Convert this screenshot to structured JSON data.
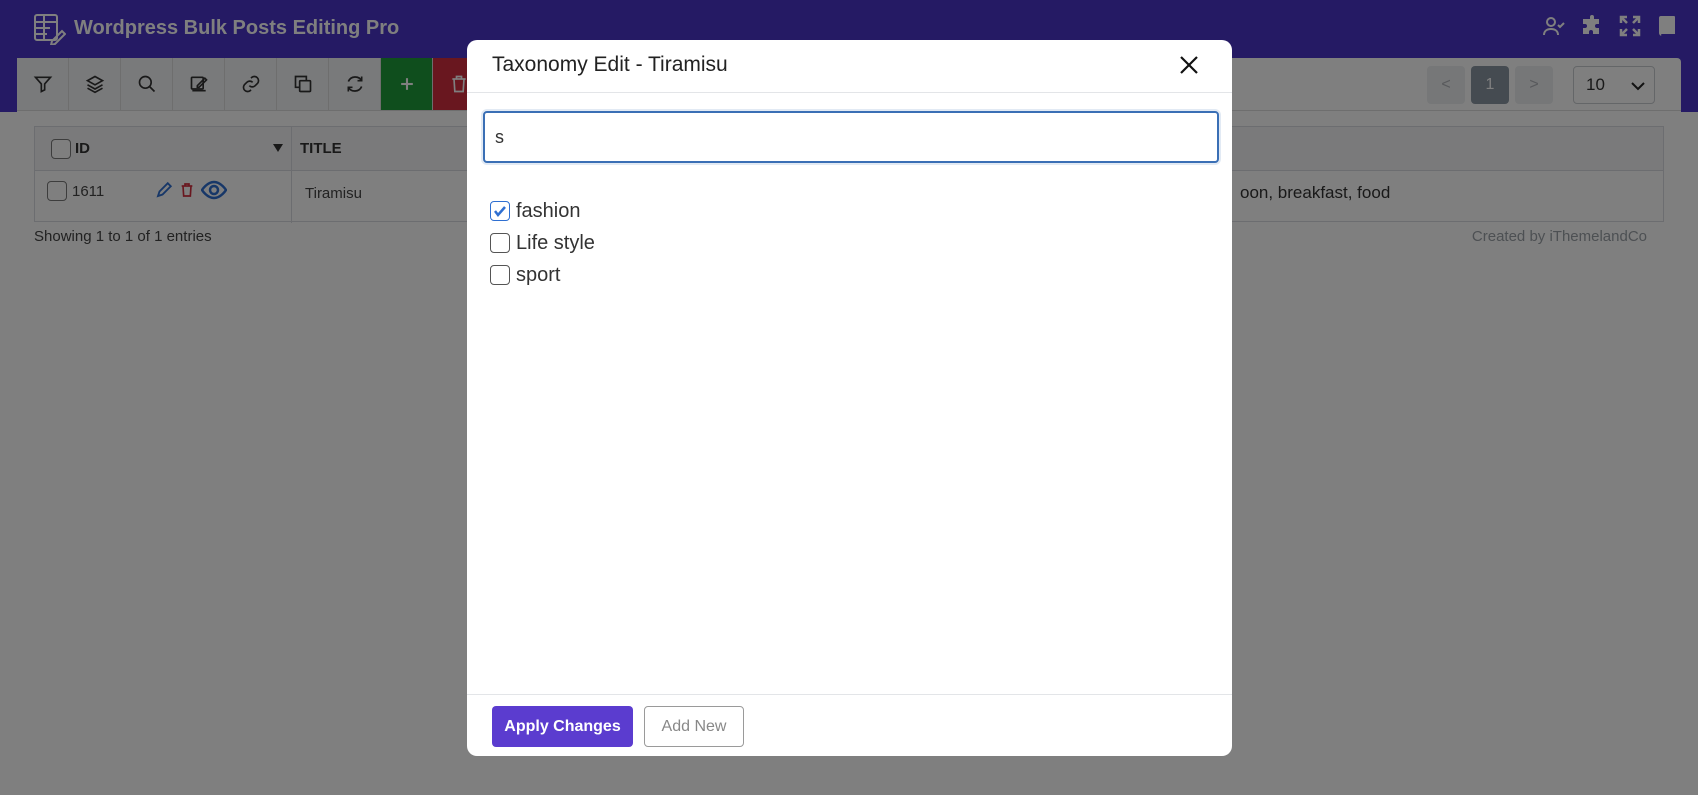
{
  "app": {
    "title": "Wordpress Bulk Posts Editing Pro"
  },
  "header_icons": [
    "user-check-icon",
    "puzzle-icon",
    "fullscreen-icon",
    "book-icon"
  ],
  "toolbar": {
    "buttons": [
      "filter-icon",
      "layers-icon",
      "search-icon",
      "edit-icon",
      "link-icon",
      "copy-icon",
      "refresh-icon",
      "plus-icon",
      "trash-icon"
    ]
  },
  "pagination": {
    "prev": "<",
    "current": "1",
    "next": ">",
    "per_page": "10"
  },
  "table": {
    "columns": [
      "ID",
      "TITLE"
    ],
    "rows": [
      {
        "id": "1611",
        "title": "Tiramisu",
        "taxonomy": "oon, breakfast, food"
      }
    ]
  },
  "footer": {
    "showing": "Showing 1 to 1 of 1 entries",
    "credit": "Created by iThemelandCo"
  },
  "modal": {
    "title": "Taxonomy Edit - Tiramisu",
    "search_value": "s",
    "items": [
      {
        "label": "fashion",
        "checked": true
      },
      {
        "label": "Life style",
        "checked": false
      },
      {
        "label": "sport",
        "checked": false
      }
    ],
    "apply_label": "Apply Changes",
    "add_new_label": "Add New"
  },
  "colors": {
    "header": "#4b35c9",
    "apply_button": "#5b3ccf",
    "add_button": "#1f9d3a",
    "delete_button": "#d32f3f"
  }
}
